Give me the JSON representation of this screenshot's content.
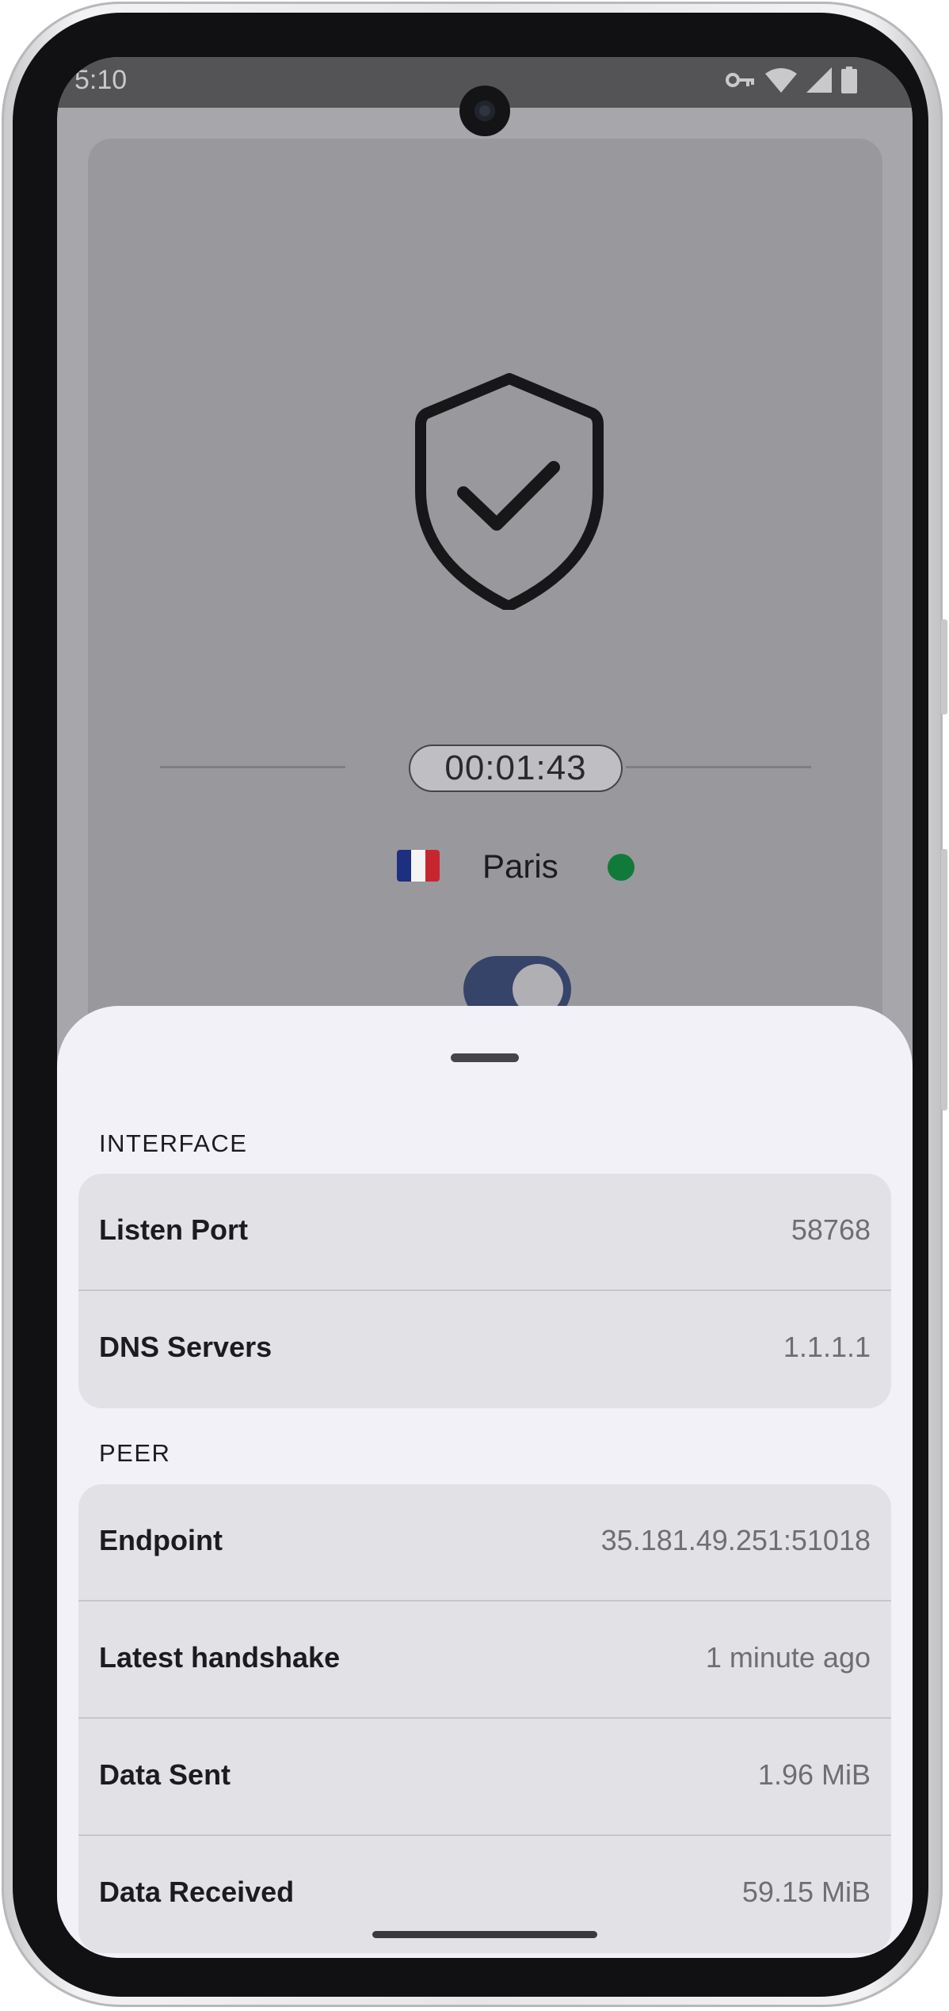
{
  "status_bar": {
    "time": "5:10",
    "icons": [
      "key-icon",
      "wifi-icon",
      "signal-icon",
      "battery-icon"
    ]
  },
  "connection": {
    "timer": "00:01:43",
    "location": "Paris",
    "flag": "france-flag-icon",
    "status_color": "#117a3b",
    "toggle_on": true
  },
  "sheet": {
    "sections": [
      {
        "title": "INTERFACE",
        "rows": [
          {
            "label": "Listen Port",
            "value": "58768"
          },
          {
            "label": "DNS Servers",
            "value": "1.1.1.1"
          }
        ]
      },
      {
        "title": "PEER",
        "rows": [
          {
            "label": "Endpoint",
            "value": "35.181.49.251:51018"
          },
          {
            "label": "Latest handshake",
            "value": "1 minute ago"
          },
          {
            "label": "Data Sent",
            "value": "1.96 MiB"
          },
          {
            "label": "Data Received",
            "value": "59.15 MiB"
          }
        ]
      }
    ]
  }
}
